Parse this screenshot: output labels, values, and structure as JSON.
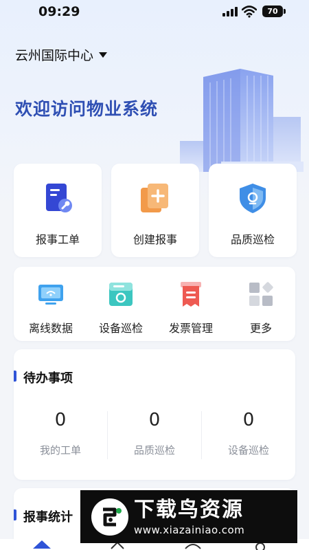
{
  "status_bar": {
    "time": "09:29",
    "battery": "70"
  },
  "header": {
    "location": "云州国际中心",
    "welcome": "欢迎访问物业系统"
  },
  "quick_actions": [
    {
      "label": "报事工单",
      "icon": "work-order-icon"
    },
    {
      "label": "创建报事",
      "icon": "create-report-icon"
    },
    {
      "label": "品质巡检",
      "icon": "quality-inspection-icon"
    }
  ],
  "grid_actions": [
    {
      "label": "离线数据",
      "icon": "offline-data-icon"
    },
    {
      "label": "设备巡检",
      "icon": "device-inspection-icon"
    },
    {
      "label": "发票管理",
      "icon": "invoice-icon"
    },
    {
      "label": "更多",
      "icon": "more-icon"
    }
  ],
  "todo": {
    "title": "待办事项",
    "items": [
      {
        "count": "0",
        "label": "我的工单"
      },
      {
        "count": "0",
        "label": "品质巡检"
      },
      {
        "count": "0",
        "label": "设备巡检"
      }
    ]
  },
  "stats": {
    "title": "报事统计"
  },
  "watermark": {
    "title": "下载鸟资源",
    "url": "www.xiazainiao.com"
  },
  "colors": {
    "accent": "#2f54d7",
    "title_blue": "#2f4fb3",
    "background": "#f3f5f9"
  }
}
